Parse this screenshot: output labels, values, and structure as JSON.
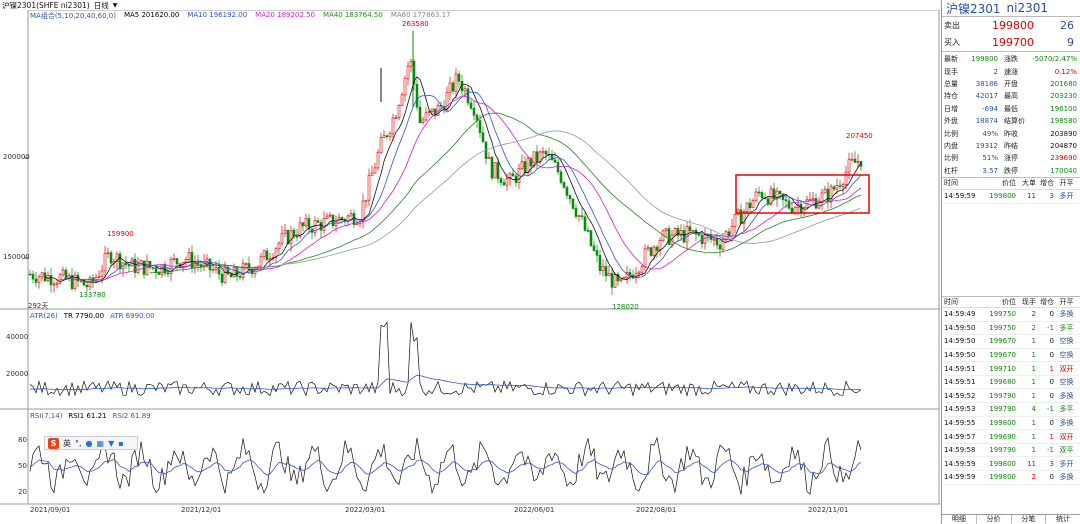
{
  "title_bar": {
    "symbol": "沪镍2301(SHFE ni2301)",
    "period": "日线"
  },
  "legend_main": [
    {
      "text": "MA组合(5,10,20,40,60,0)",
      "color": "#3355aa"
    },
    {
      "text": "MA5 201620.00",
      "color": "#000000"
    },
    {
      "text": "MA10 196192.00",
      "color": "#3355cc"
    },
    {
      "text": "MA20 189202.50",
      "color": "#cc22cc"
    },
    {
      "text": "MA40 183764.50",
      "color": "#228822"
    },
    {
      "text": "MA60 177863.17",
      "color": "#888888"
    }
  ],
  "legend_atr": [
    {
      "text": "ATR(26)",
      "color": "#3355aa"
    },
    {
      "text": "TR 7790.00",
      "color": "#000000"
    },
    {
      "text": "ATR 6990.00",
      "color": "#3355cc"
    }
  ],
  "legend_rsi": [
    {
      "text": "RSI(7,14)",
      "color": "#3355aa"
    },
    {
      "text": "RSI1 61.21",
      "color": "#000000"
    },
    {
      "text": "RSI2 61.89",
      "color": "#3355cc"
    }
  ],
  "annotations": {
    "high": "263580",
    "low": "128020",
    "left_high": "159900",
    "left_low": "133780",
    "recent": "207450",
    "days": "292天"
  },
  "y_labels_main": [
    "200000",
    "150000"
  ],
  "y_labels_atr": [
    "40000",
    "20000"
  ],
  "y_labels_rsi": [
    "80",
    "50",
    "20"
  ],
  "x_labels": [
    "2021/09/01",
    "2021/12/01",
    "2022/03/01",
    "2022/06/01",
    "2022/08/01",
    "2022/11/01"
  ],
  "chart_data": {
    "type": "candlestick",
    "symbol": "沪镍2301",
    "visible_values": {
      "high": 263580,
      "low": 128020,
      "left_high": 159900,
      "left_low": 133780,
      "recent_high": 207450
    },
    "indicators": {
      "MA5": 201620.0,
      "MA10": 196192.0,
      "MA20": 189202.5,
      "MA40": 183764.5,
      "MA60": 177863.17,
      "TR": 7790.0,
      "ATR": 6990.0,
      "RSI1": 61.21,
      "RSI2": 61.89
    }
  },
  "panel": {
    "title": "沪镍2301",
    "code": "ni2301",
    "ask_label": "卖出",
    "ask_price": "199800",
    "ask_vol": "26",
    "bid_label": "买入",
    "bid_price": "199700",
    "bid_vol": "9",
    "quote": [
      {
        "k": "最新",
        "v": "199800",
        "vc": "green",
        "k2": "涨跌",
        "v2": "-5070/2.47%",
        "v2c": "green"
      },
      {
        "k": "现手",
        "v": "2",
        "vc": "blue",
        "k2": "速涨",
        "v2": "0.12%",
        "v2c": "red"
      },
      {
        "k": "总量",
        "v": "38186",
        "vc": "blue",
        "k2": "开盘",
        "v2": "201680",
        "v2c": "green"
      },
      {
        "k": "持仓",
        "v": "42017",
        "vc": "blue",
        "k2": "最高",
        "v2": "203230",
        "v2c": "green"
      },
      {
        "k": "日增",
        "v": "-694",
        "vc": "blue",
        "k2": "最低",
        "v2": "196100",
        "v2c": "green"
      },
      {
        "k": "外盘",
        "v": "18874",
        "vc": "blue",
        "k2": "结算价",
        "v2": "198580",
        "v2c": "green"
      },
      {
        "k": "比例",
        "v": "49%",
        "vc": "blue",
        "k2": "昨收",
        "v2": "203890",
        "v2c": "black"
      },
      {
        "k": "内盘",
        "v": "19312",
        "vc": "blue",
        "k2": "昨结",
        "v2": "204870",
        "v2c": "black"
      },
      {
        "k": "比例",
        "v": "51%",
        "vc": "blue",
        "k2": "涨停",
        "v2": "239690",
        "v2c": "red"
      },
      {
        "k": "杠杆",
        "v": "3.57",
        "vc": "blue",
        "k2": "跌停",
        "v2": "170040",
        "v2c": "green"
      }
    ],
    "tick_header": [
      "时间",
      "价位",
      "大单",
      "增仓",
      "开平"
    ],
    "tick_top": [
      {
        "t": "14:59:59",
        "p": "199800",
        "v": "11",
        "d": "3",
        "o": "多开",
        "vc": "red",
        "oc": "blue"
      }
    ],
    "tick_header2": [
      "时间",
      "价位",
      "现手",
      "增仓",
      "开平"
    ],
    "ticks": [
      {
        "t": "14:59:49",
        "p": "199750",
        "v": "2",
        "d": "0",
        "o": "多换",
        "vc": "red",
        "oc": "blue"
      },
      {
        "t": "14:59:50",
        "p": "199750",
        "v": "2",
        "d": "-1",
        "o": "多平",
        "vc": "green",
        "oc": "green"
      },
      {
        "t": "14:59:50",
        "p": "199670",
        "v": "1",
        "d": "0",
        "o": "空换",
        "vc": "green",
        "oc": "blue"
      },
      {
        "t": "14:59:50",
        "p": "199670",
        "v": "1",
        "d": "0",
        "o": "空换",
        "vc": "green",
        "oc": "blue"
      },
      {
        "t": "14:59:51",
        "p": "199710",
        "v": "1",
        "d": "1",
        "o": "双开",
        "vc": "green",
        "oc": "red"
      },
      {
        "t": "14:59:51",
        "p": "199680",
        "v": "1",
        "d": "0",
        "o": "空换",
        "vc": "green",
        "oc": "blue"
      },
      {
        "t": "14:59:52",
        "p": "199790",
        "v": "1",
        "d": "0",
        "o": "多换",
        "vc": "green",
        "oc": "blue"
      },
      {
        "t": "14:59:53",
        "p": "199790",
        "v": "4",
        "d": "-1",
        "o": "多平",
        "vc": "green",
        "oc": "green"
      },
      {
        "t": "14:59:55",
        "p": "199800",
        "v": "1",
        "d": "0",
        "o": "多换",
        "vc": "green",
        "oc": "blue"
      },
      {
        "t": "14:59:57",
        "p": "199690",
        "v": "1",
        "d": "1",
        "o": "双开",
        "vc": "green",
        "oc": "red"
      },
      {
        "t": "14:59:58",
        "p": "199790",
        "v": "1",
        "d": "-1",
        "o": "双平",
        "vc": "green",
        "oc": "green"
      },
      {
        "t": "14:59:59",
        "p": "199800",
        "v": "11",
        "d": "3",
        "o": "多开",
        "vc": "red",
        "oc": "blue"
      },
      {
        "t": "14:59:59",
        "p": "199800",
        "v": "2",
        "d": "0",
        "o": "多换",
        "vc": "red",
        "oc": "blue"
      }
    ],
    "tabs": [
      "明细",
      "分价",
      "分笔",
      "统计"
    ]
  },
  "ime": {
    "logo": "S",
    "lang": "英"
  }
}
